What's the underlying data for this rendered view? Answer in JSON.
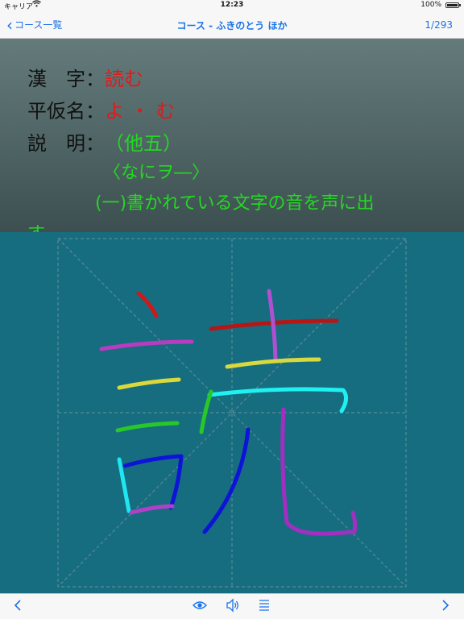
{
  "status_bar": {
    "carrier": "キャリア",
    "time": "12:23",
    "battery": "100%"
  },
  "nav": {
    "back_label": "コース一覧",
    "title": "コース - ふきのとう ほか",
    "counter": "1/293"
  },
  "info": {
    "kanji_label": "漢　字：",
    "kanji_value": "読む",
    "kana_label": "平仮名：",
    "kana_value": "よ ・ む",
    "desc_label": "説　明：",
    "desc_line1": "（他五）",
    "desc_line2": "〈なにヲ―〉",
    "desc_line3": "(一)書かれている文字の音を声に出",
    "desc_line4": "す。"
  },
  "canvas": {
    "character": "読",
    "stroke_count": 14
  },
  "colors": {
    "accent": "#1a73e8",
    "kanji_red": "#e01a1a",
    "desc_green": "#23d823",
    "canvas_bg": "#166d80"
  },
  "toolbar": {
    "prev_icon": "chevron-left-icon",
    "eye_icon": "eye-icon",
    "speaker_icon": "speaker-icon",
    "list_icon": "list-icon",
    "next_icon": "chevron-right-icon"
  }
}
